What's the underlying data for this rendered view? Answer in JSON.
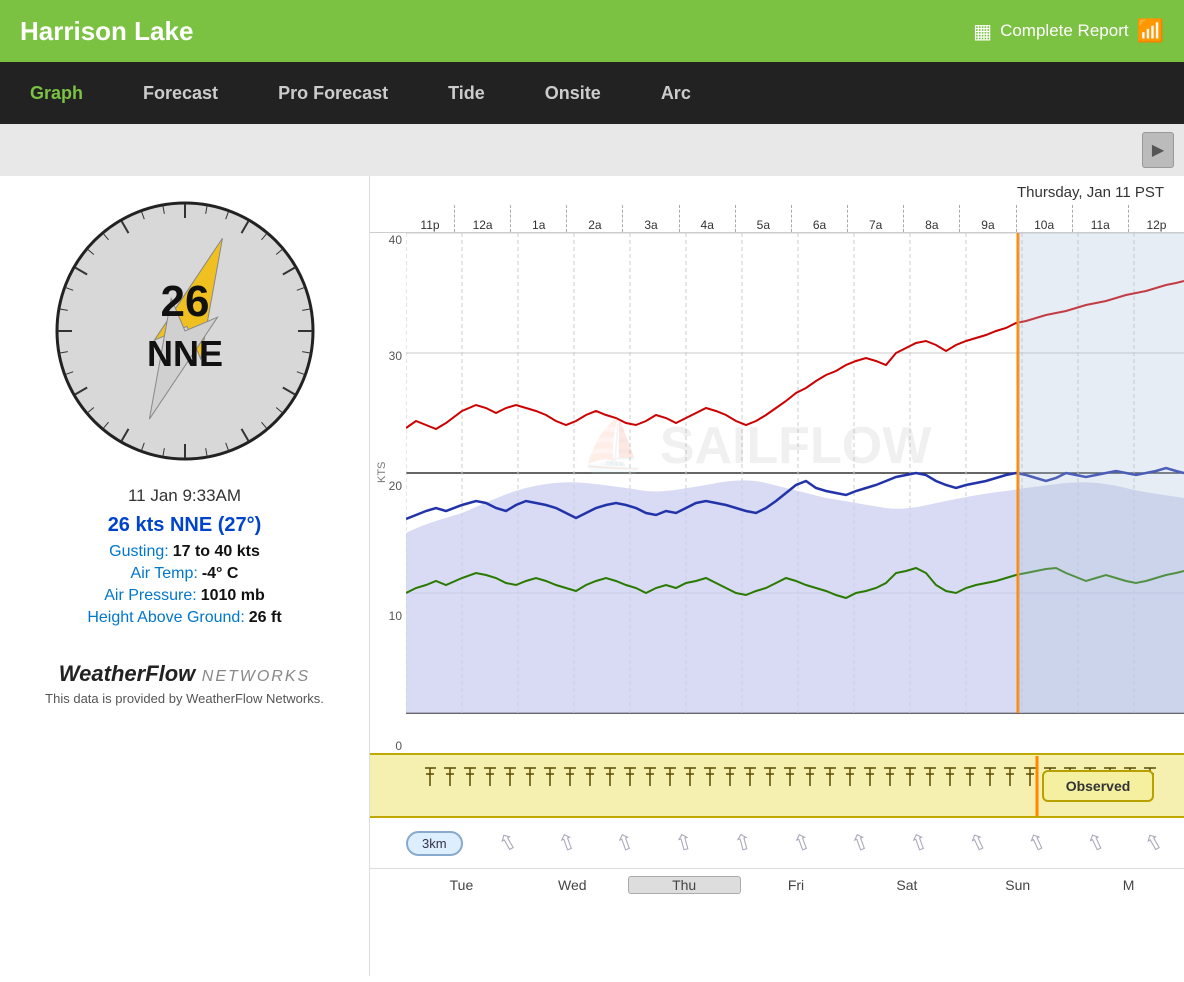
{
  "header": {
    "title": "Harrison Lake",
    "report_label": "Complete Report",
    "wifi_icon": "wifi"
  },
  "nav": {
    "items": [
      {
        "label": "Graph",
        "active": true
      },
      {
        "label": "Forecast",
        "active": false
      },
      {
        "label": "Pro Forecast",
        "active": false
      },
      {
        "label": "Tide",
        "active": false
      },
      {
        "label": "Onsite",
        "active": false
      },
      {
        "label": "Arc",
        "active": false
      }
    ]
  },
  "compass": {
    "speed": "26",
    "direction": "NNE",
    "degrees": 27
  },
  "weather": {
    "datetime": "11 Jan 9:33AM",
    "wind": "26 kts NNE (27°)",
    "gusting_label": "Gusting:",
    "gusting_value": "17 to 40 kts",
    "air_temp_label": "Air Temp:",
    "air_temp_value": "-4° C",
    "air_pressure_label": "Air Pressure:",
    "air_pressure_value": "1010 mb",
    "height_label": "Height Above Ground:",
    "height_value": "26 ft"
  },
  "weatherflow": {
    "logo_text": "WeatherFlow",
    "logo_networks": "NETWORKS",
    "caption": "This data is provided by WeatherFlow Networks."
  },
  "chart": {
    "date_label": "Thursday, Jan 11 PST",
    "time_labels": [
      "11p",
      "12a",
      "1a",
      "2a",
      "3a",
      "4a",
      "5a",
      "6a",
      "7a",
      "8a",
      "9a",
      "10a",
      "11a",
      "12p"
    ],
    "y_labels": [
      "0",
      "10",
      "20",
      "30",
      "40"
    ],
    "y_label": "KTS",
    "vis_badge": "3km",
    "observed_label": "Observed",
    "day_labels": [
      "Tue",
      "Wed",
      "Thu",
      "Fri",
      "Sat",
      "Sun",
      "M"
    ],
    "day_active_index": 2
  }
}
